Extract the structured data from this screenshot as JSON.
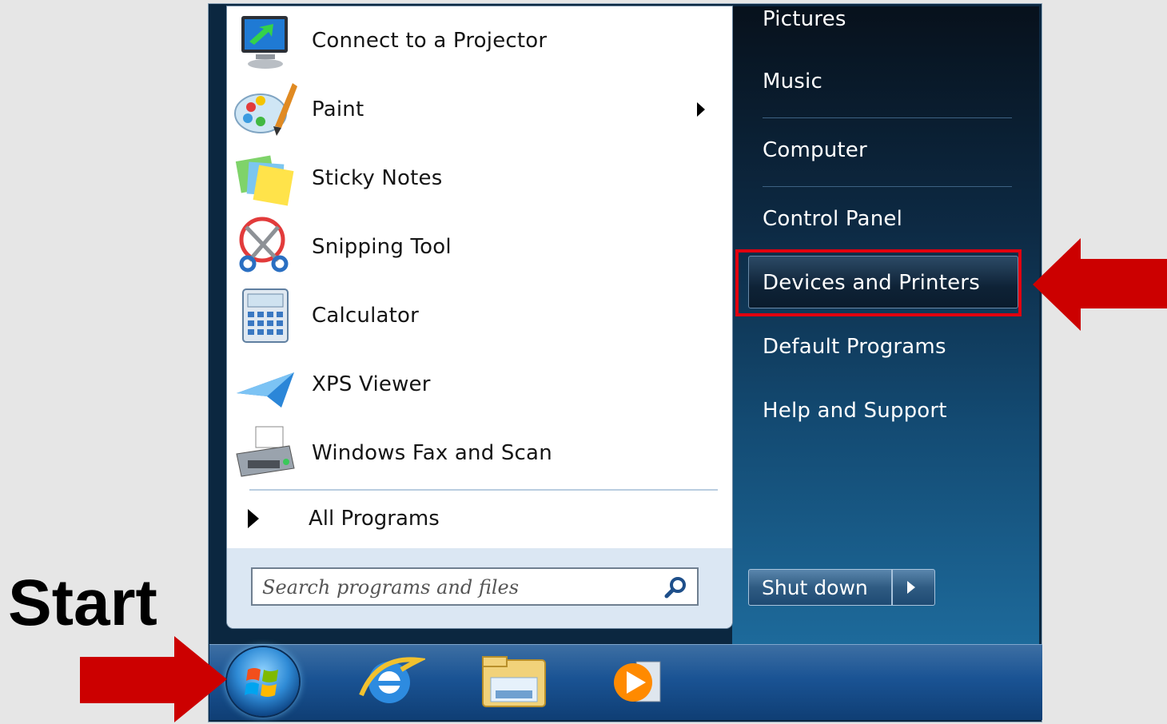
{
  "start_menu": {
    "programs": [
      {
        "label": "Connect to a Projector",
        "icon": "projector-icon"
      },
      {
        "label": "Paint",
        "icon": "paint-icon",
        "has_submenu": true
      },
      {
        "label": "Sticky Notes",
        "icon": "sticky-notes-icon"
      },
      {
        "label": "Snipping Tool",
        "icon": "snipping-tool-icon"
      },
      {
        "label": "Calculator",
        "icon": "calculator-icon"
      },
      {
        "label": "XPS Viewer",
        "icon": "xps-viewer-icon"
      },
      {
        "label": "Windows Fax and Scan",
        "icon": "fax-scan-icon"
      }
    ],
    "all_programs_label": "All Programs",
    "search": {
      "placeholder": "Search programs and files"
    },
    "right_column": [
      {
        "label": "Pictures"
      },
      {
        "label": "Music"
      },
      {
        "label": "Computer"
      },
      {
        "label": "Control Panel"
      },
      {
        "label": "Devices and Printers",
        "highlighted": true
      },
      {
        "label": "Default Programs"
      },
      {
        "label": "Help and Support"
      }
    ],
    "shutdown_label": "Shut down"
  },
  "taskbar": {
    "items": [
      "start-orb",
      "internet-explorer-icon",
      "windows-explorer-icon",
      "media-player-icon"
    ]
  },
  "annotation": {
    "start_label": "Start",
    "arrow_color": "#cc0000",
    "highlight_color": "#e1000f"
  }
}
